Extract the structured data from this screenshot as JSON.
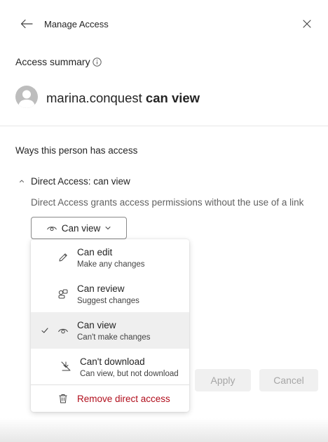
{
  "header": {
    "title": "Manage Access"
  },
  "summary": {
    "label": "Access summary",
    "user_name": "marina.conquest",
    "user_permission": "can view"
  },
  "ways": {
    "label": "Ways this person has access",
    "direct": {
      "label": "Direct Access: can view",
      "description": "Direct Access grants access permissions without the use of a link",
      "dropdown_value": "Can view"
    }
  },
  "menu": {
    "items": [
      {
        "title": "Can edit",
        "subtitle": "Make any changes",
        "icon": "pencil-icon"
      },
      {
        "title": "Can review",
        "subtitle": "Suggest changes",
        "icon": "review-icon"
      },
      {
        "title": "Can view",
        "subtitle": "Can't make changes",
        "icon": "eye-icon",
        "selected": true
      },
      {
        "title": "Can't download",
        "subtitle": "Can view, but not download",
        "icon": "no-download-icon"
      }
    ],
    "remove_label": "Remove direct access"
  },
  "actions": {
    "apply_label": "Apply",
    "cancel_label": "Cancel"
  },
  "colors": {
    "danger": "#b10e1c",
    "selected_bg": "#efefef",
    "text": "#242424",
    "muted": "#616161"
  }
}
